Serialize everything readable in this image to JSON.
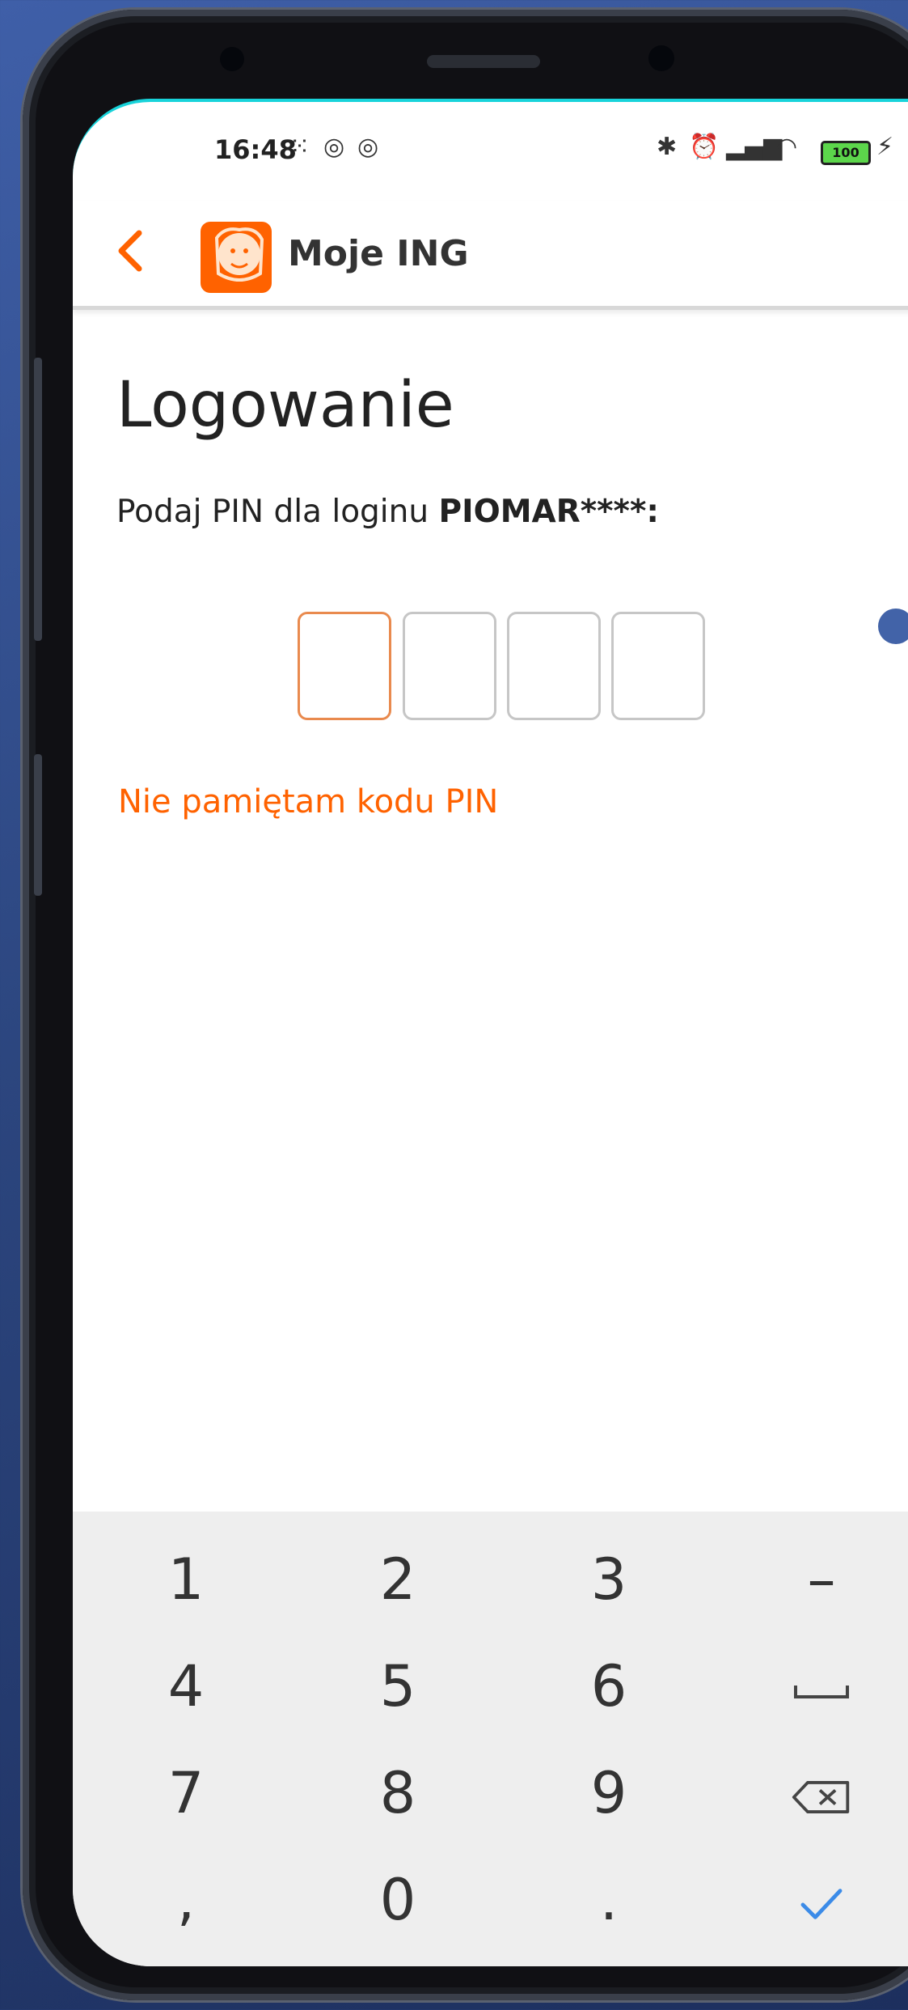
{
  "status": {
    "time": "16:48",
    "battery": "100"
  },
  "appbar": {
    "title": "Moje ING"
  },
  "login": {
    "heading": "Logowanie",
    "prompt": "Podaj PIN dla loginu ",
    "login_masked": "PIOMAR****:",
    "forgot": "Nie pamiętam kodu PIN"
  },
  "keypad": {
    "k1": "1",
    "k2": "2",
    "k3": "3",
    "minus": "–",
    "k4": "4",
    "k5": "5",
    "k6": "6",
    "k7": "7",
    "k8": "8",
    "k9": "9",
    "comma": ",",
    "k0": "0",
    "period": "."
  },
  "colors": {
    "brand": "#ff6200",
    "accent_teal": "#18d3da",
    "check_blue": "#3b8be8"
  }
}
